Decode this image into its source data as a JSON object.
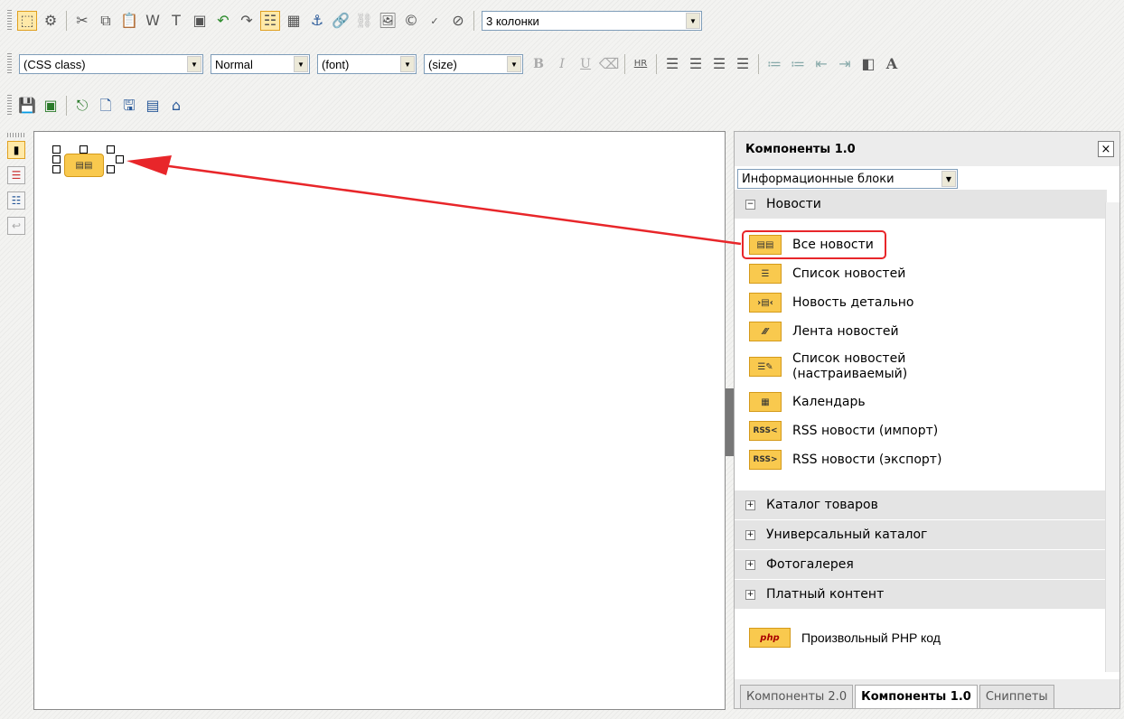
{
  "toolbar1": {
    "template_select": "3 колонки"
  },
  "toolbar2": {
    "css_class": "(CSS class)",
    "format": "Normal",
    "font": "(font)",
    "size": "(size)",
    "bold": "B",
    "italic": "I",
    "underline": "U",
    "hr": "HR"
  },
  "panel": {
    "title": "Компоненты 1.0",
    "close": "×",
    "category": "Информационные блоки",
    "sections": [
      "Новости",
      "Каталог товаров",
      "Универсальный каталог",
      "Фотогалерея",
      "Платный контент"
    ],
    "items": [
      {
        "label": "Все новости",
        "icon": "news-all-icon",
        "icon_text": "▤▤"
      },
      {
        "label": "Список новостей",
        "icon": "news-list-icon",
        "icon_text": "☰"
      },
      {
        "label": "Новость детально",
        "icon": "news-detail-icon",
        "icon_text": "›▤‹"
      },
      {
        "label": "Лента новостей",
        "icon": "news-feed-icon",
        "icon_text": "⁄⁄⁄"
      },
      {
        "label": "Список новостей",
        "label2": "(настраиваемый)",
        "icon": "news-list-custom-icon",
        "icon_text": "☰✎"
      },
      {
        "label": "Календарь",
        "icon": "calendar-icon",
        "icon_text": "▦"
      },
      {
        "label": "RSS новости (импорт)",
        "icon": "rss-import-icon",
        "icon_text": "RSS<"
      },
      {
        "label": "RSS новости (экспорт)",
        "icon": "rss-export-icon",
        "icon_text": "RSS>"
      }
    ],
    "php": {
      "label": "Произвольный PHP код",
      "icon_text": "php"
    },
    "tabs": [
      "Компоненты 2.0",
      "Компоненты 1.0",
      "Сниппеты"
    ]
  },
  "colors": {
    "accent_red": "#e8262a",
    "icon_yellow": "#f9c94e"
  }
}
